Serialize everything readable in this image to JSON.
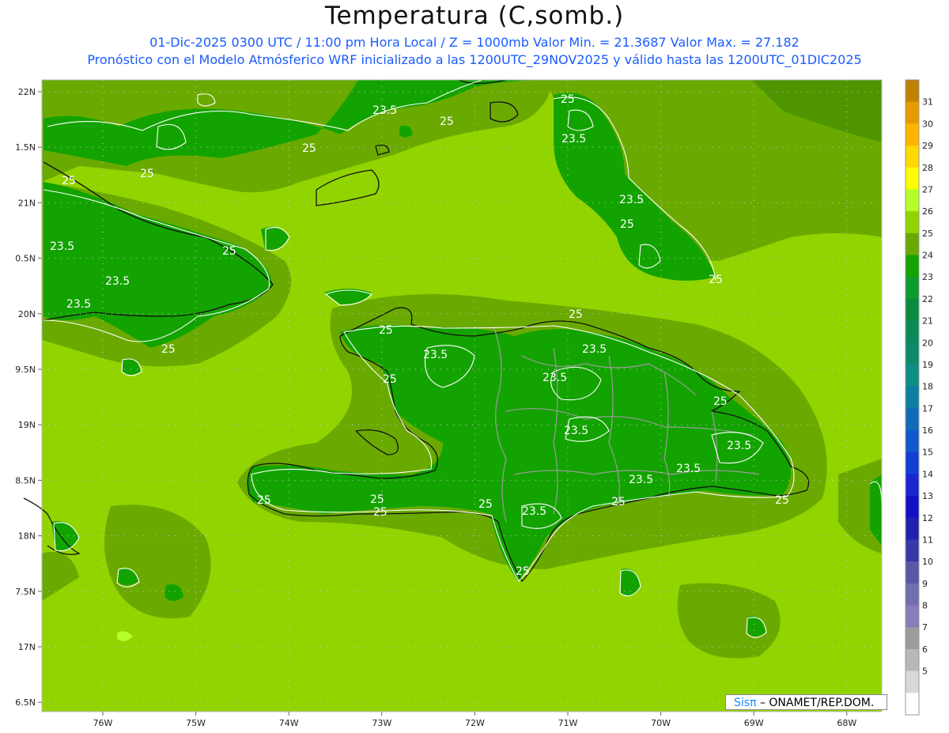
{
  "header": {
    "title": "Temperatura (C,somb.)",
    "subtitle_1": "01-Dic-2025 0300 UTC / 11:00 pm Hora Local / Z = 1000mb   Valor Min. = 21.3687  Valor Max. = 27.182",
    "subtitle_2": "Pronóstico con el Modelo Atmósferico WRF inicializado a las 1200UTC_29NOV2025 y válido hasta las  1200UTC_01DIC2025"
  },
  "axes": {
    "lat_labels": [
      "22N",
      "1.5N",
      "21N",
      "0.5N",
      "20N",
      "9.5N",
      "19N",
      "8.5N",
      "18N",
      "7.5N",
      "17N",
      "6.5N"
    ],
    "lon_labels": [
      "76W",
      "75W",
      "74W",
      "73W",
      "72W",
      "71W",
      "70W",
      "69W",
      "68W"
    ]
  },
  "colorbar": {
    "labels": [
      "31",
      "30",
      "29",
      "28",
      "27",
      "26",
      "25",
      "24",
      "23",
      "22",
      "21",
      "20",
      "19",
      "18",
      "17",
      "16",
      "15",
      "14",
      "13",
      "12",
      "11",
      "10",
      "9",
      "8",
      "7",
      "6",
      "5"
    ],
    "colors": [
      "#c08000",
      "#e69a00",
      "#ffb400",
      "#ffd800",
      "#ffff00",
      "#b4ff28",
      "#92d400",
      "#6aaa00",
      "#13a300",
      "#0c9c2c",
      "#098c3f",
      "#0a8a56",
      "#0c8a6a",
      "#0e8f84",
      "#0c7fa0",
      "#0e6cb8",
      "#1058cf",
      "#1240d6",
      "#1a26d2",
      "#1110c4",
      "#2020b0",
      "#3838a8",
      "#5858a8",
      "#7070ae",
      "#8a7cb8",
      "#9c9c9c",
      "#b8b8b8",
      "#d8d8d8",
      "#ffffff"
    ]
  },
  "contour_labels": {
    "label_25": "25",
    "label_23_5": "23.5"
  },
  "credit": {
    "brand": "Sisπ",
    "org": "– ONAMET/REP.DOM."
  }
}
